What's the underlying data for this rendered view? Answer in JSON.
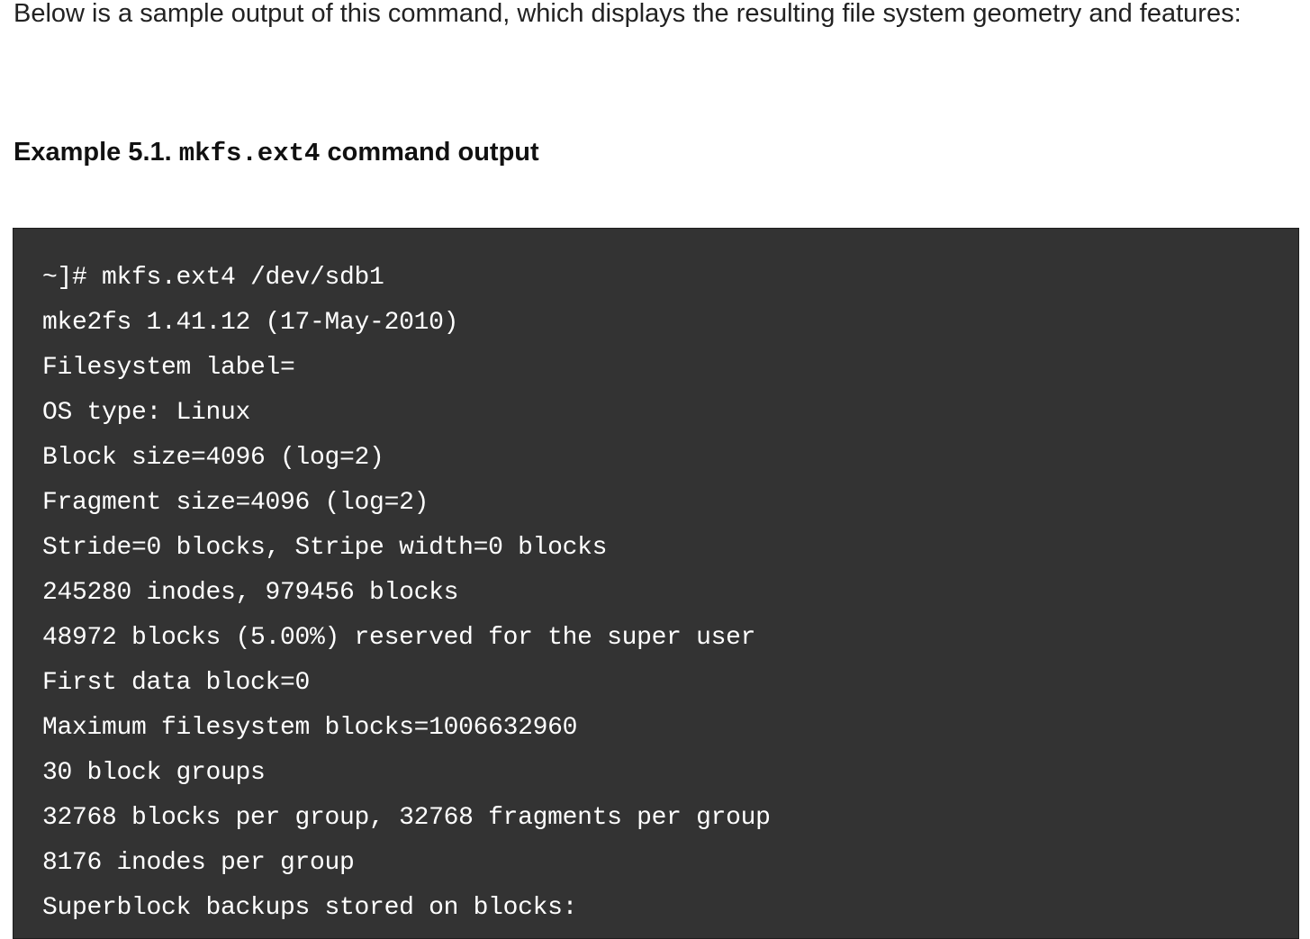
{
  "intro": {
    "text": "Below is a sample output of this command, which displays the resulting file system geometry and features:"
  },
  "example": {
    "prefix": "Example 5.1. ",
    "command": "mkfs.ext4",
    "suffix": " command output"
  },
  "terminal": {
    "lines": [
      "~]# mkfs.ext4 /dev/sdb1",
      "mke2fs 1.41.12 (17-May-2010)",
      "Filesystem label=",
      "OS type: Linux",
      "Block size=4096 (log=2)",
      "Fragment size=4096 (log=2)",
      "Stride=0 blocks, Stripe width=0 blocks",
      "245280 inodes, 979456 blocks",
      "48972 blocks (5.00%) reserved for the super user",
      "First data block=0",
      "Maximum filesystem blocks=1006632960",
      "30 block groups",
      "32768 blocks per group, 32768 fragments per group",
      "8176 inodes per group",
      "Superblock backups stored on blocks:"
    ]
  }
}
